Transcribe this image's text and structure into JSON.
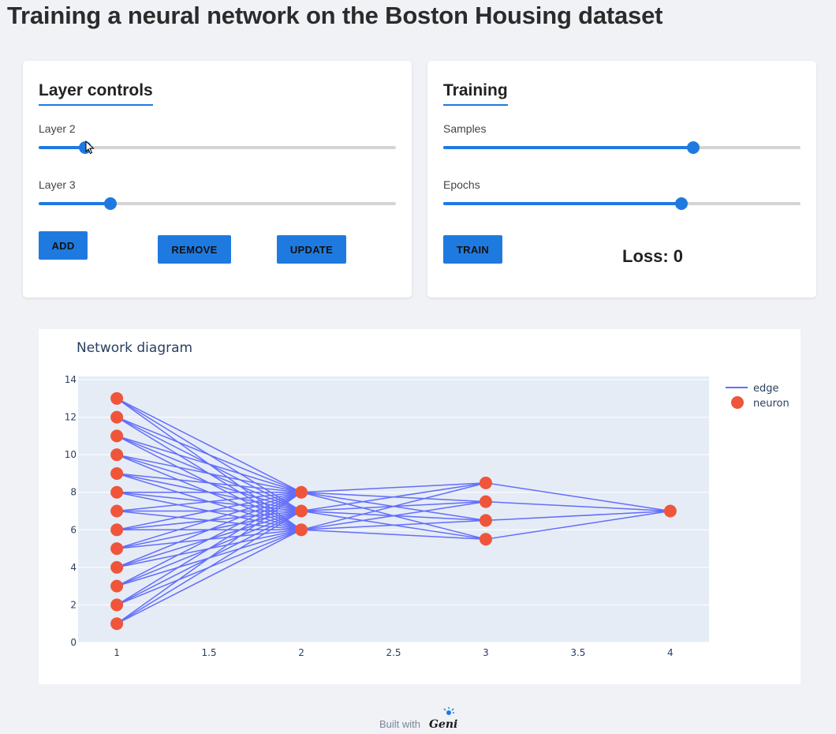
{
  "title": "Training a neural network on the Boston Housing dataset",
  "layer_controls": {
    "heading": "Layer controls",
    "sliders": [
      {
        "label": "Layer 2",
        "value_fraction": 0.13
      },
      {
        "label": "Layer 3",
        "value_fraction": 0.2
      }
    ],
    "buttons": {
      "add": "ADD",
      "remove": "REMOVE",
      "update": "UPDATE"
    }
  },
  "training": {
    "heading": "Training",
    "sliders": [
      {
        "label": "Samples",
        "value_fraction": 0.7
      },
      {
        "label": "Epochs",
        "value_fraction": 0.667
      }
    ],
    "train_label": "TRAIN",
    "loss_text": "Loss: 0"
  },
  "network_diagram": {
    "title": "Network diagram"
  },
  "chart_data": {
    "type": "scatter",
    "title": "Network diagram",
    "xlabel": "",
    "ylabel": "",
    "xlim": [
      0.79,
      4.21
    ],
    "ylim": [
      0,
      14.17
    ],
    "x_ticks": [
      "1",
      "1.5",
      "2",
      "2.5",
      "3",
      "3.5",
      "4"
    ],
    "y_ticks": [
      "0",
      "2",
      "4",
      "6",
      "8",
      "10",
      "12",
      "14"
    ],
    "legend": {
      "placement": "top-right",
      "entries": [
        "edge",
        "neuron"
      ]
    },
    "colors": {
      "edge": "#636efa",
      "neuron": "#ef553b",
      "plot_bg": "#e5ecf6"
    },
    "layers": [
      {
        "x": 1,
        "y": [
          1,
          2,
          3,
          4,
          5,
          6,
          7,
          8,
          9,
          10,
          11,
          12,
          13
        ]
      },
      {
        "x": 2,
        "y": [
          6,
          7,
          8
        ]
      },
      {
        "x": 3,
        "y": [
          5.5,
          6.5,
          7.5,
          8.5
        ]
      },
      {
        "x": 4,
        "y": [
          7
        ]
      }
    ],
    "series": [
      {
        "name": "edge",
        "mode": "lines",
        "connectivity": "fully connected between consecutive layers"
      },
      {
        "name": "neuron",
        "mode": "markers"
      }
    ]
  },
  "footer": {
    "built_with": "Built with",
    "logo_text": "Genie"
  }
}
